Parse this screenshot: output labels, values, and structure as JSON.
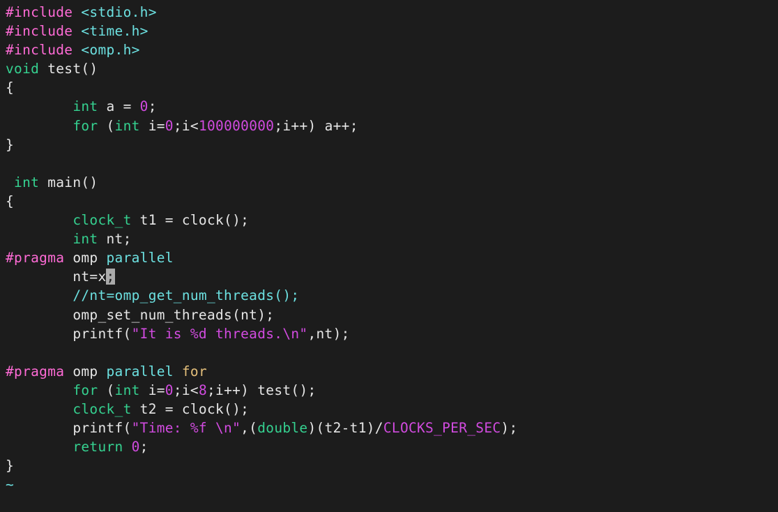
{
  "code": {
    "lines": [
      {
        "tokens": [
          {
            "t": "#include ",
            "c": "hash"
          },
          {
            "t": "<stdio.h>",
            "c": "inc"
          }
        ]
      },
      {
        "tokens": [
          {
            "t": "#include ",
            "c": "hash"
          },
          {
            "t": "<time.h>",
            "c": "inc"
          }
        ]
      },
      {
        "tokens": [
          {
            "t": "#include ",
            "c": "hash"
          },
          {
            "t": "<omp.h>",
            "c": "inc"
          }
        ]
      },
      {
        "tokens": [
          {
            "t": "void",
            "c": "kw"
          },
          {
            "t": " test()",
            "c": "id"
          }
        ]
      },
      {
        "tokens": [
          {
            "t": "{",
            "c": "id"
          }
        ]
      },
      {
        "tokens": [
          {
            "t": "        ",
            "c": "id"
          },
          {
            "t": "int",
            "c": "kw"
          },
          {
            "t": " a = ",
            "c": "id"
          },
          {
            "t": "0",
            "c": "num"
          },
          {
            "t": ";",
            "c": "id"
          }
        ]
      },
      {
        "tokens": [
          {
            "t": "        ",
            "c": "id"
          },
          {
            "t": "for",
            "c": "kw"
          },
          {
            "t": " (",
            "c": "id"
          },
          {
            "t": "int",
            "c": "kw"
          },
          {
            "t": " i=",
            "c": "id"
          },
          {
            "t": "0",
            "c": "num"
          },
          {
            "t": ";i<",
            "c": "id"
          },
          {
            "t": "100000000",
            "c": "num"
          },
          {
            "t": ";i++) a++;",
            "c": "id"
          }
        ]
      },
      {
        "tokens": [
          {
            "t": "}",
            "c": "id"
          }
        ]
      },
      {
        "tokens": [
          {
            "t": "",
            "c": "id"
          }
        ]
      },
      {
        "tokens": [
          {
            "t": " ",
            "c": "id"
          },
          {
            "t": "int",
            "c": "kw"
          },
          {
            "t": " main()",
            "c": "id"
          }
        ]
      },
      {
        "tokens": [
          {
            "t": "{",
            "c": "id"
          }
        ]
      },
      {
        "tokens": [
          {
            "t": "        ",
            "c": "id"
          },
          {
            "t": "clock_t",
            "c": "kw"
          },
          {
            "t": " t1 = clock();",
            "c": "id"
          }
        ]
      },
      {
        "tokens": [
          {
            "t": "        ",
            "c": "id"
          },
          {
            "t": "int",
            "c": "kw"
          },
          {
            "t": " nt;",
            "c": "id"
          }
        ]
      },
      {
        "tokens": [
          {
            "t": "#pragma ",
            "c": "hash"
          },
          {
            "t": "omp ",
            "c": "id"
          },
          {
            "t": "parallel",
            "c": "pr2"
          }
        ]
      },
      {
        "tokens": [
          {
            "t": "        nt=x",
            "c": "id"
          },
          {
            "t": ";",
            "c": "cursor"
          }
        ]
      },
      {
        "tokens": [
          {
            "t": "        ",
            "c": "id"
          },
          {
            "t": "//nt=omp_get_num_threads();",
            "c": "com"
          }
        ]
      },
      {
        "tokens": [
          {
            "t": "        omp_set_num_threads(nt);",
            "c": "id"
          }
        ]
      },
      {
        "tokens": [
          {
            "t": "        printf(",
            "c": "id"
          },
          {
            "t": "\"It is %d threads.\\n\"",
            "c": "str"
          },
          {
            "t": ",nt);",
            "c": "id"
          }
        ]
      },
      {
        "tokens": [
          {
            "t": "",
            "c": "id"
          }
        ]
      },
      {
        "tokens": [
          {
            "t": "#pragma ",
            "c": "hash"
          },
          {
            "t": "omp ",
            "c": "id"
          },
          {
            "t": "parallel ",
            "c": "pr2"
          },
          {
            "t": "for",
            "c": "pry"
          }
        ]
      },
      {
        "tokens": [
          {
            "t": "        ",
            "c": "id"
          },
          {
            "t": "for",
            "c": "kw"
          },
          {
            "t": " (",
            "c": "id"
          },
          {
            "t": "int",
            "c": "kw"
          },
          {
            "t": " i=",
            "c": "id"
          },
          {
            "t": "0",
            "c": "num"
          },
          {
            "t": ";i<",
            "c": "id"
          },
          {
            "t": "8",
            "c": "num"
          },
          {
            "t": ";i++) test();",
            "c": "id"
          }
        ]
      },
      {
        "tokens": [
          {
            "t": "        ",
            "c": "id"
          },
          {
            "t": "clock_t",
            "c": "kw"
          },
          {
            "t": " t2 = clock();",
            "c": "id"
          }
        ]
      },
      {
        "tokens": [
          {
            "t": "        printf(",
            "c": "id"
          },
          {
            "t": "\"Time: %f \\n\"",
            "c": "str"
          },
          {
            "t": ",(",
            "c": "id"
          },
          {
            "t": "double",
            "c": "kw"
          },
          {
            "t": ")(t2-t1)/",
            "c": "id"
          },
          {
            "t": "CLOCKS_PER_SEC",
            "c": "cst"
          },
          {
            "t": ");",
            "c": "id"
          }
        ]
      },
      {
        "tokens": [
          {
            "t": "        ",
            "c": "id"
          },
          {
            "t": "return",
            "c": "kw"
          },
          {
            "t": " ",
            "c": "id"
          },
          {
            "t": "0",
            "c": "num"
          },
          {
            "t": ";",
            "c": "id"
          }
        ]
      },
      {
        "tokens": [
          {
            "t": "}",
            "c": "id"
          }
        ]
      },
      {
        "tokens": [
          {
            "t": "~",
            "c": "tld"
          }
        ]
      }
    ]
  }
}
